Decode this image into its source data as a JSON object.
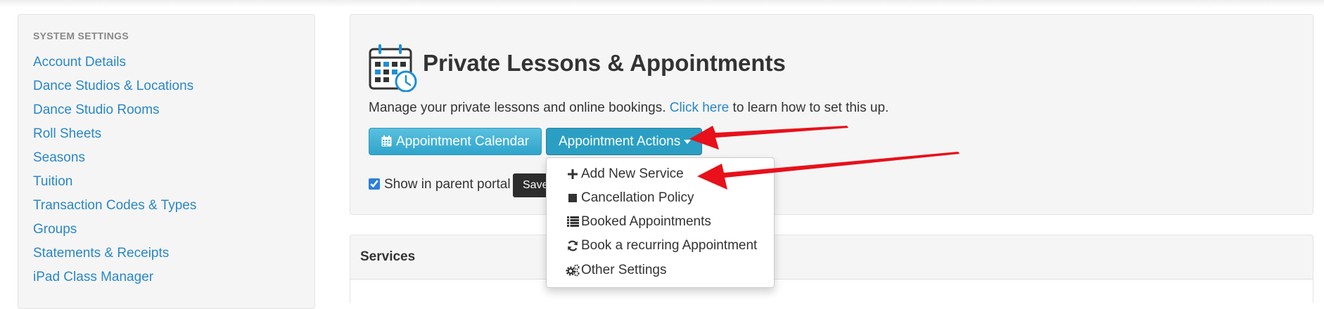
{
  "sidebar": {
    "heading": "SYSTEM SETTINGS",
    "items": [
      {
        "label": "Account Details"
      },
      {
        "label": "Dance Studios & Locations"
      },
      {
        "label": "Dance Studio Rooms"
      },
      {
        "label": "Roll Sheets"
      },
      {
        "label": "Seasons"
      },
      {
        "label": "Tuition"
      },
      {
        "label": "Transaction Codes & Types"
      },
      {
        "label": "Groups"
      },
      {
        "label": "Statements & Receipts"
      },
      {
        "label": "iPad Class Manager"
      }
    ]
  },
  "main": {
    "title": "Private Lessons & Appointments",
    "description_prefix": "Manage your private lessons and online bookings.",
    "description_link": "Click here",
    "description_suffix": "to learn how to set this up.",
    "calendar_button": "Appointment Calendar",
    "actions_button": "Appointment Actions",
    "show_portal_label": "Show in parent portal",
    "show_portal_checked": true,
    "save_button": "Save"
  },
  "dropdown": {
    "items": [
      {
        "label": "Add New Service",
        "icon": "plus-icon"
      },
      {
        "label": "Cancellation Policy",
        "icon": "stop-icon"
      },
      {
        "label": "Booked Appointments",
        "icon": "list-icon"
      },
      {
        "label": "Book a recurring Appointment",
        "icon": "refresh-icon"
      },
      {
        "label": "Other Settings",
        "icon": "cogs-icon"
      }
    ]
  },
  "services": {
    "title": "Services"
  },
  "colors": {
    "link": "#2a87c5",
    "button_info": "#5bc0de",
    "button_actions": "#2b9fc3",
    "annotation_arrow": "#e8101a"
  }
}
